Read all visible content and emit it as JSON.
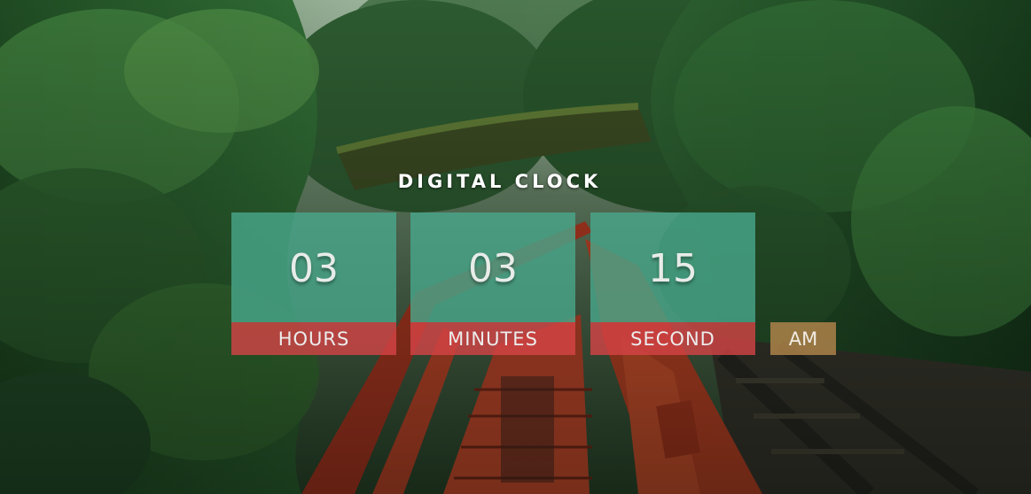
{
  "clock": {
    "title": "DIGITAL CLOCK",
    "hours": {
      "value": "03",
      "label": "HOURS"
    },
    "minutes": {
      "value": "03",
      "label": "MINUTES"
    },
    "seconds": {
      "value": "15",
      "label": "SECOND"
    },
    "period": "AM"
  },
  "colors": {
    "digit_panel": "#48a88c",
    "label_panel": "#d64446",
    "period_panel": "#a88048",
    "text": "#e8ece9"
  },
  "background": {
    "scene": "forest-red-bridge-photo"
  }
}
